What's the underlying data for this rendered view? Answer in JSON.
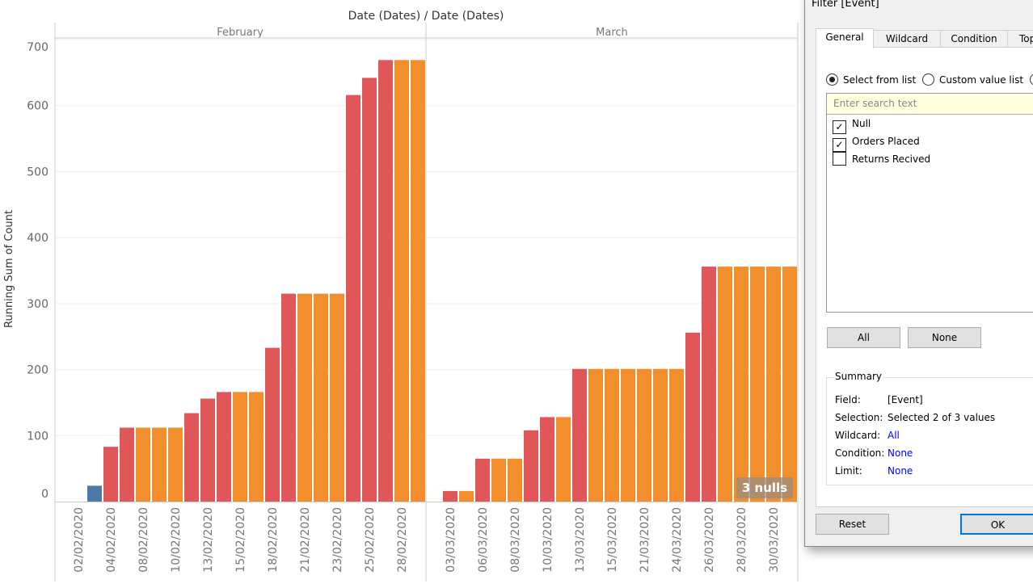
{
  "chart_data": {
    "type": "bar",
    "title": "Date (Dates) / Date (Dates)",
    "ylabel": "Running Sum of Count",
    "ylim": [
      0,
      700
    ],
    "yticks": [
      0,
      100,
      200,
      300,
      400,
      500,
      600,
      700
    ],
    "grid": true,
    "colors": {
      "blue": "#4e79a7",
      "red": "#e15759",
      "orange": "#f28e2b"
    },
    "panes": [
      {
        "name": "February",
        "tick_labels": [
          "02/02/2020",
          "04/02/2020",
          "08/02/2020",
          "10/02/2020",
          "13/02/2020",
          "15/02/2020",
          "18/02/2020",
          "21/02/2020",
          "23/02/2020",
          "25/02/2020",
          "28/02/2020"
        ],
        "values": [
          0,
          24,
          83,
          112,
          112,
          112,
          112,
          134,
          156,
          166,
          166,
          166,
          233,
          315,
          315,
          315,
          315,
          616,
          642,
          669,
          669,
          669
        ],
        "bar_colors": [
          "blue",
          "blue",
          "red",
          "red",
          "orange",
          "orange",
          "orange",
          "red",
          "red",
          "red",
          "orange",
          "orange",
          "red",
          "red",
          "orange",
          "orange",
          "orange",
          "red",
          "red",
          "red",
          "orange",
          "orange"
        ]
      },
      {
        "name": "March",
        "tick_labels": [
          "03/03/2020",
          "06/03/2020",
          "08/03/2020",
          "10/03/2020",
          "13/03/2020",
          "15/03/2020",
          "21/03/2020",
          "24/03/2020",
          "26/03/2020",
          "28/03/2020",
          "30/03/2020"
        ],
        "values": [
          16,
          16,
          65,
          65,
          65,
          108,
          128,
          128,
          201,
          201,
          201,
          201,
          201,
          201,
          201,
          256,
          356,
          356,
          356,
          356,
          356,
          356
        ],
        "bar_colors": [
          "red",
          "orange",
          "red",
          "orange",
          "orange",
          "red",
          "red",
          "orange",
          "red",
          "orange",
          "orange",
          "orange",
          "orange",
          "orange",
          "orange",
          "red",
          "red",
          "orange",
          "orange",
          "orange",
          "orange",
          "orange"
        ]
      }
    ],
    "nulls_indicator": "3 nulls"
  },
  "dialog": {
    "title": "Filter [Event]",
    "tabs": [
      "General",
      "Wildcard",
      "Condition",
      "Top"
    ],
    "active_tab": "General",
    "radios": [
      "Select from list",
      "Custom value list",
      ""
    ],
    "search_placeholder": "Enter search text",
    "items": [
      {
        "label": "Null",
        "checked": true
      },
      {
        "label": "Orders Placed",
        "checked": true
      },
      {
        "label": "Returns Recived",
        "checked": false
      }
    ],
    "all_button": "All",
    "none_button": "None",
    "summary": {
      "legend": "Summary",
      "field_label": "Field:",
      "field": "[Event]",
      "selection_label": "Selection:",
      "selection": "Selected 2 of 3 values",
      "wildcard_label": "Wildcard:",
      "wildcard": "All",
      "condition_label": "Condition:",
      "condition": "None",
      "limit_label": "Limit:",
      "limit": "None"
    },
    "reset_button": "Reset",
    "ok_button": "OK"
  }
}
